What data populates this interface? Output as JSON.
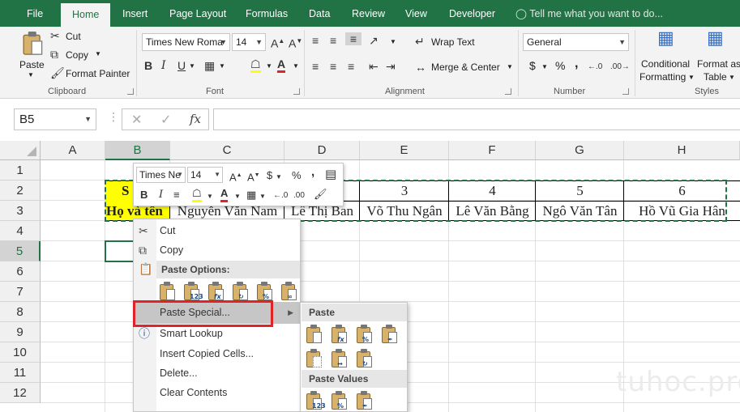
{
  "tabs": [
    "File",
    "Home",
    "Insert",
    "Page Layout",
    "Formulas",
    "Data",
    "Review",
    "View",
    "Developer"
  ],
  "tell_me": "Tell me what you want to do...",
  "ribbon": {
    "clipboard": {
      "paste": "Paste",
      "cut": "Cut",
      "copy": "Copy",
      "format_painter": "Format Painter",
      "label": "Clipboard"
    },
    "font": {
      "name": "Times New Roma",
      "size": "14",
      "label": "Font"
    },
    "alignment": {
      "wrap": "Wrap Text",
      "merge": "Merge & Center",
      "label": "Alignment"
    },
    "number": {
      "format": "General",
      "currency": "$",
      "percent": "%",
      "comma": ",",
      "label": "Number"
    },
    "styles": {
      "cond1": "Conditional",
      "cond2": "Formatting",
      "fmt1": "Format as",
      "fmt2": "Table",
      "label": "Styles"
    }
  },
  "formula_bar": {
    "name_box": "B5",
    "fx": "fx"
  },
  "grid": {
    "columns": [
      "A",
      "B",
      "C",
      "D",
      "E",
      "F",
      "G",
      "H"
    ],
    "rows": [
      "1",
      "2",
      "3",
      "4",
      "5",
      "6",
      "7",
      "8",
      "9",
      "10",
      "11",
      "12"
    ],
    "row2": {
      "b": "S",
      "e": "3",
      "f": "4",
      "g": "5",
      "h": "6"
    },
    "row3": {
      "b": "Họ và tên",
      "c": "Nguyễn Văn Nam",
      "d": "Lê Thị Ban",
      "e": "Võ Thu Ngân",
      "f": "Lê Văn Bằng",
      "g": "Ngô Văn Tân",
      "h": "Hồ Vũ Gia Hân"
    }
  },
  "minibar": {
    "font": "Times Ne",
    "size": "14",
    "currency": "$",
    "percent": "%",
    "comma": ",",
    "bold": "B",
    "italic": "I"
  },
  "context_menu": {
    "cut": "Cut",
    "copy": "Copy",
    "paste_options": "Paste Options:",
    "paste_special": "Paste Special...",
    "smart_lookup": "Smart Lookup",
    "insert_copied": "Insert Copied Cells...",
    "delete": "Delete...",
    "clear_contents": "Clear Contents"
  },
  "submenu": {
    "paste": "Paste",
    "paste_values": "Paste Values"
  },
  "watermark": "tuhoc.pro",
  "colors": {
    "excel_green": "#217346",
    "highlight_yellow": "#ffff00",
    "callout_red": "#e2222a"
  }
}
